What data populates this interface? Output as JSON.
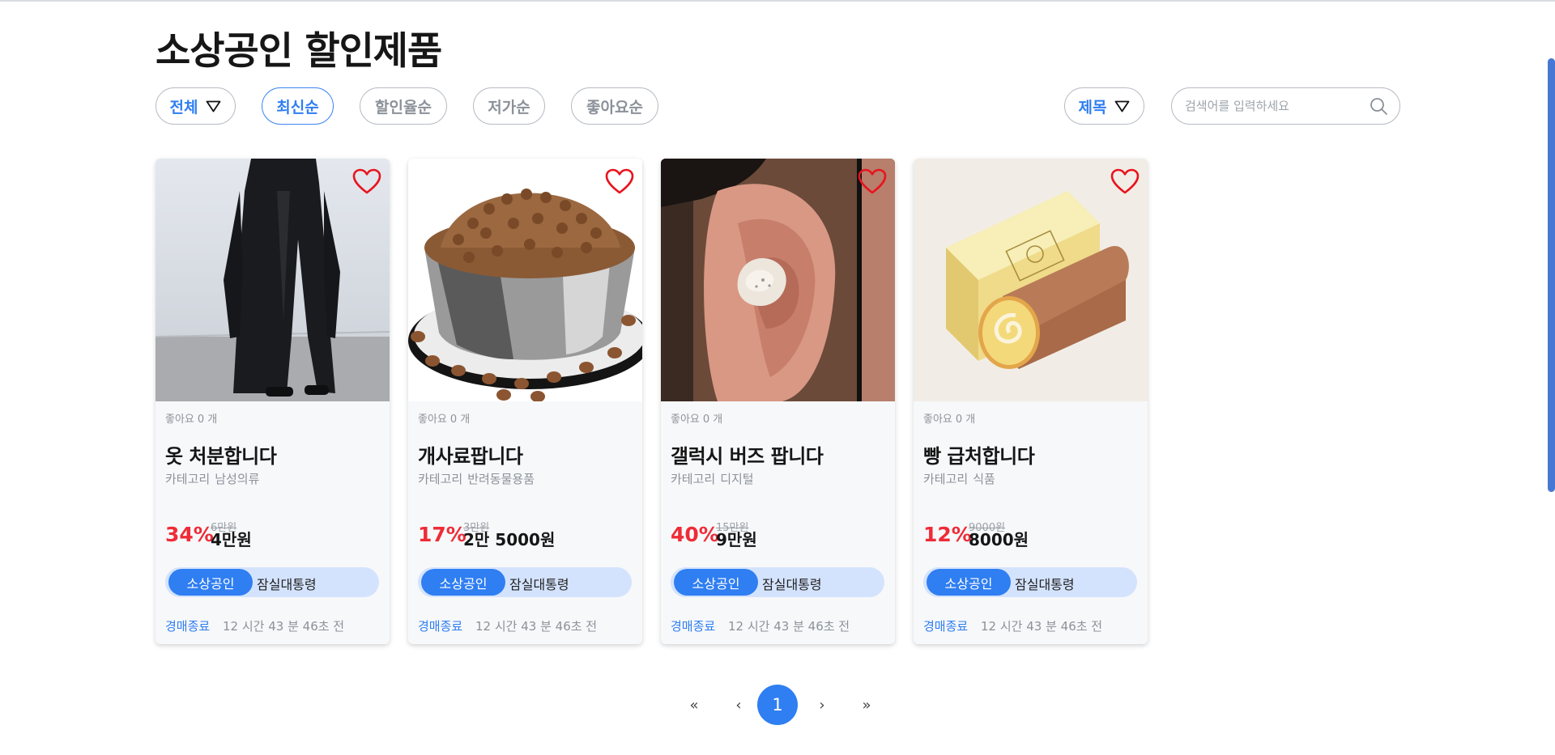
{
  "page": {
    "title": "소상공인 할인제품"
  },
  "filters": {
    "scope": {
      "label": "전체"
    },
    "sorts": [
      {
        "label": "최신순",
        "active": true
      },
      {
        "label": "할인율순",
        "active": false
      },
      {
        "label": "저가순",
        "active": false
      },
      {
        "label": "좋아요순",
        "active": false
      }
    ],
    "search_field": {
      "label": "제목"
    },
    "search": {
      "placeholder": "검색어를 입력하세요"
    }
  },
  "colors": {
    "accent": "#2f7ef2",
    "discount": "#ee2c37",
    "heart": "#e8141e",
    "seller_bg": "#d4e3fd"
  },
  "products": [
    {
      "image_icon": "black-coat-photo",
      "likes_label": "좋아요",
      "likes_count": "0 개",
      "name": "옷 처분합니다",
      "category_label": "카테고리",
      "category": "남성의류",
      "discount_rate": "34%",
      "original_price": "6만원",
      "sale_price": "4만원",
      "seller_badge": "소상공인",
      "seller_name": "잠실대통령",
      "status": "경매종료",
      "time_left": "12 시간 43 분 46초 전"
    },
    {
      "image_icon": "dog-food-bowl-photo",
      "likes_label": "좋아요",
      "likes_count": "0 개",
      "name": "개사료팝니다",
      "category_label": "카테고리",
      "category": "반려동물용품",
      "discount_rate": "17%",
      "original_price": "3만원",
      "sale_price": "2만 5000원",
      "seller_badge": "소상공인",
      "seller_name": "잠실대통령",
      "status": "경매종료",
      "time_left": "12 시간 43 분 46초 전"
    },
    {
      "image_icon": "galaxy-buds-ear-photo",
      "likes_label": "좋아요",
      "likes_count": "0 개",
      "name": "갤럭시 버즈 팝니다",
      "category_label": "카테고리",
      "category": "디지털",
      "discount_rate": "40%",
      "original_price": "15만원",
      "sale_price": "9만원",
      "seller_badge": "소상공인",
      "seller_name": "잠실대통령",
      "status": "경매종료",
      "time_left": "12 시간 43 분 46초 전"
    },
    {
      "image_icon": "roll-cake-photo",
      "likes_label": "좋아요",
      "likes_count": "0 개",
      "name": "빵 급처합니다",
      "category_label": "카테고리",
      "category": "식품",
      "discount_rate": "12%",
      "original_price": "9000원",
      "sale_price": "8000원",
      "seller_badge": "소상공인",
      "seller_name": "잠실대통령",
      "status": "경매종료",
      "time_left": "12 시간 43 분 46초 전"
    }
  ],
  "pagination": {
    "first": "«",
    "prev": "‹",
    "current": "1",
    "next": "›",
    "last": "»"
  }
}
